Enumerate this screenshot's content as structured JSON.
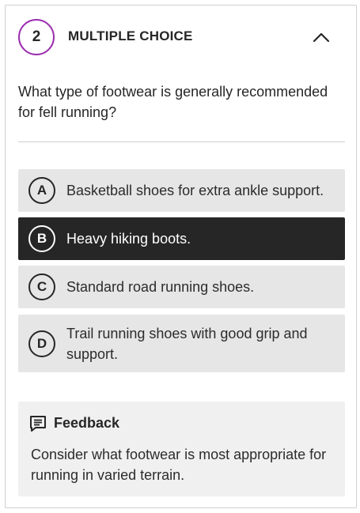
{
  "question": {
    "number": "2",
    "type_label": "MULTIPLE CHOICE",
    "text": "What type of footwear is generally recommended for fell running?",
    "collapse_icon": "chevron-up-icon"
  },
  "options": [
    {
      "letter": "A",
      "text": "Basketball shoes for extra ankle support.",
      "selected": false
    },
    {
      "letter": "B",
      "text": "Heavy hiking boots.",
      "selected": true
    },
    {
      "letter": "C",
      "text": "Standard road running shoes.",
      "selected": false
    },
    {
      "letter": "D",
      "text": "Trail running shoes with good grip and support.",
      "selected": false
    }
  ],
  "feedback": {
    "title": "Feedback",
    "icon": "feedback-icon",
    "text": "Consider what footwear is most appropriate for running in varied terrain."
  },
  "colors": {
    "question_number_ring": "#9c2fb0",
    "selected_option_bg": "#262626",
    "option_bg": "#e6e6e6",
    "feedback_bg": "#f0f0f0"
  }
}
